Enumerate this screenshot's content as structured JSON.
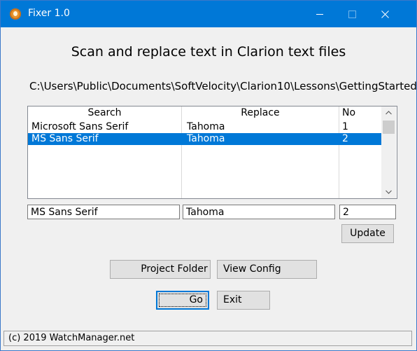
{
  "window": {
    "title": "Fixer 1.0"
  },
  "heading": "Scan and replace text in Clarion text files",
  "path": "C:\\Users\\Public\\Documents\\SoftVelocity\\Clarion10\\Lessons\\GettingStarted\\",
  "table": {
    "columns": [
      "Search",
      "Replace",
      "No"
    ],
    "rows": [
      {
        "search": "Microsoft Sans Serif",
        "replace": "Tahoma",
        "no": "1",
        "selected": false
      },
      {
        "search": "MS Sans Serif",
        "replace": "Tahoma",
        "no": "2",
        "selected": true
      }
    ]
  },
  "edit": {
    "search": "MS Sans Serif",
    "replace": "Tahoma",
    "no": "2"
  },
  "buttons": {
    "update": "Update",
    "project_folder": "Project Folder",
    "view_config": "View Config",
    "go": "Go",
    "exit": "Exit"
  },
  "status": "(c) 2019 WatchManager.net",
  "colors": {
    "titlebar": "#0078d7",
    "selection": "#0078d7",
    "app_icon": "#e8932d"
  },
  "icons": {
    "app": "app-icon",
    "minimize": "minimize-icon",
    "maximize": "maximize-icon",
    "close": "close-icon",
    "scroll_up": "chevron-up-icon",
    "scroll_down": "chevron-down-icon"
  }
}
